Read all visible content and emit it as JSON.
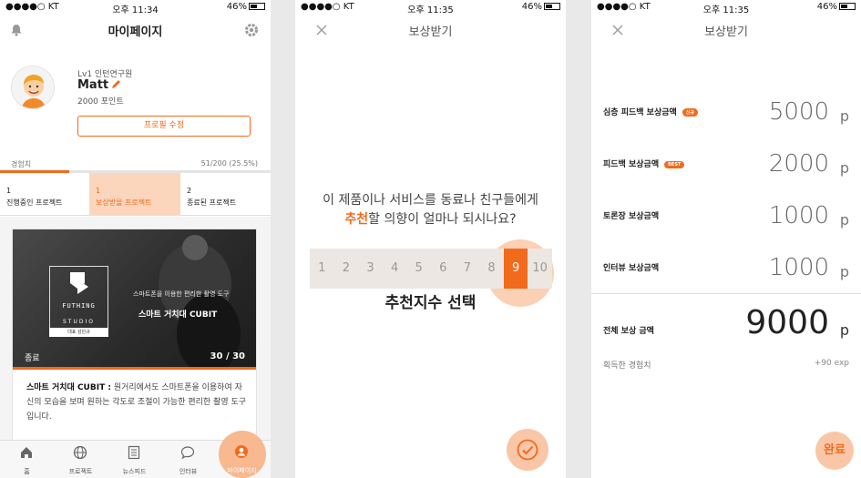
{
  "screen1": {
    "status": {
      "carrier": "●●●●○ KT",
      "time": "오후 11:34",
      "battery": "46%"
    },
    "title": "마이페이지",
    "profile": {
      "level": "Lv1 인턴연구원",
      "name": "Matt",
      "points": "2000 포인트",
      "edit_button": "프로필 수정"
    },
    "xp": {
      "label": "경험치",
      "count": "51/200 (25.5%)",
      "progress": 0.255
    },
    "project_tabs": [
      {
        "count": "1",
        "label": "진행중인 프로젝트"
      },
      {
        "count": "1",
        "label": "보상받을 프로젝트"
      },
      {
        "count": "2",
        "label": "종료된 프로젝트"
      }
    ],
    "card": {
      "image_subtitle": "스마트폰을 이용한 편리한 촬영 도구",
      "image_title": "스마트 거치대 CUBIT",
      "logo_text": "FUTHING",
      "logo_sub": "STUDIO",
      "ceo": "대표 성민규",
      "status": "종료",
      "count": "30 / 30",
      "desc_title": "스마트 거치대 CUBIT :",
      "desc_body": " 원거리에서도 스마트폰을 이용하여 자신의 모습을 보며 원하는 각도로 조절이 가능한 편리한 촬영 도구입니다."
    },
    "tabbar": [
      {
        "label": "홈",
        "icon": "home-icon"
      },
      {
        "label": "프로젝트",
        "icon": "globe-icon"
      },
      {
        "label": "뉴스피드",
        "icon": "news-icon"
      },
      {
        "label": "인터뷰",
        "icon": "chat-icon"
      },
      {
        "label": "마이페이지",
        "icon": "user-icon"
      }
    ],
    "accent": "#f26a1b"
  },
  "screen2": {
    "status": {
      "carrier": "●●●●○ KT",
      "time": "오후 11:35",
      "battery": "46%"
    },
    "title": "보상받기",
    "question_line1": "이 제품이나 서비스를 동료나 친구들에게",
    "question_highlight": "추천",
    "question_line2_rest": "할 의향이 얼마나 되시나요?",
    "scale": [
      "1",
      "2",
      "3",
      "4",
      "5",
      "6",
      "7",
      "8",
      "9",
      "10"
    ],
    "selected": "9",
    "caption": "추천지수 선택"
  },
  "screen3": {
    "status": {
      "carrier": "●●●●○ KT",
      "time": "오후 11:35",
      "battery": "46%"
    },
    "title": "보상받기",
    "rewards": [
      {
        "label": "심층 피드백 보상금액",
        "badge": "신규",
        "amount": "5000",
        "unit": "p"
      },
      {
        "label": "피드백 보상금액",
        "badge": "BEST",
        "amount": "2000",
        "unit": "p"
      },
      {
        "label": "토론장 보상금액",
        "badge": "",
        "amount": "1000",
        "unit": "p"
      },
      {
        "label": "인터뷰 보상금액",
        "badge": "",
        "amount": "1000",
        "unit": "p"
      }
    ],
    "total": {
      "label": "전체 보상 금액",
      "amount": "9000",
      "unit": "p"
    },
    "exp": {
      "label": "획득한 경험치",
      "value": "+90 exp"
    },
    "done": "완료"
  }
}
